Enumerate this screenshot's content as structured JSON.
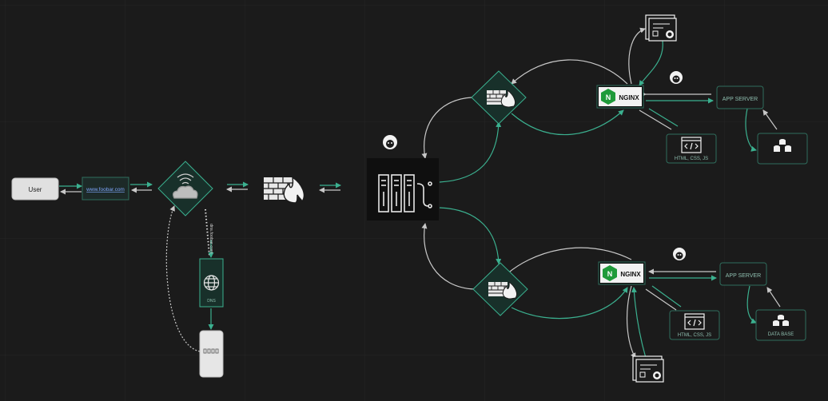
{
  "colors": {
    "background": "#1b1b1b",
    "grid": "#2a2a2a",
    "accent": "#3bb08f",
    "diamond_fill": "#18302a",
    "box_stroke": "#2f6e5d",
    "line_light": "#bdbdbd",
    "nginx_green": "#1f9a3a"
  },
  "user": {
    "label": "User"
  },
  "domain": {
    "label": "www.foobar.com"
  },
  "dns_link": {
    "label": "dns.foobar.com"
  },
  "dns_server": {
    "label": "DNS"
  },
  "nginx_top": {
    "label": "NGINX",
    "badge": "N"
  },
  "nginx_bottom": {
    "label": "NGINX",
    "badge": "N"
  },
  "app_server_top": {
    "label": "APP SERVER"
  },
  "app_server_bottom": {
    "label": "APP SERVER"
  },
  "static_top": {
    "label": "HTML, CSS, JS"
  },
  "static_bottom": {
    "label": "HTML, CSS, JS"
  },
  "database_bottom": {
    "label": "DATA BASE"
  },
  "icons": {
    "cloud": "wifi-cloud-icon",
    "firewall": "firewall-icon",
    "load_balancer": "load-balancer-icon",
    "certificate": "ssl-certificate-icon",
    "globe": "globe-icon",
    "database": "database-icon",
    "code": "code-icon",
    "monitor": "monitoring-agent-icon"
  }
}
